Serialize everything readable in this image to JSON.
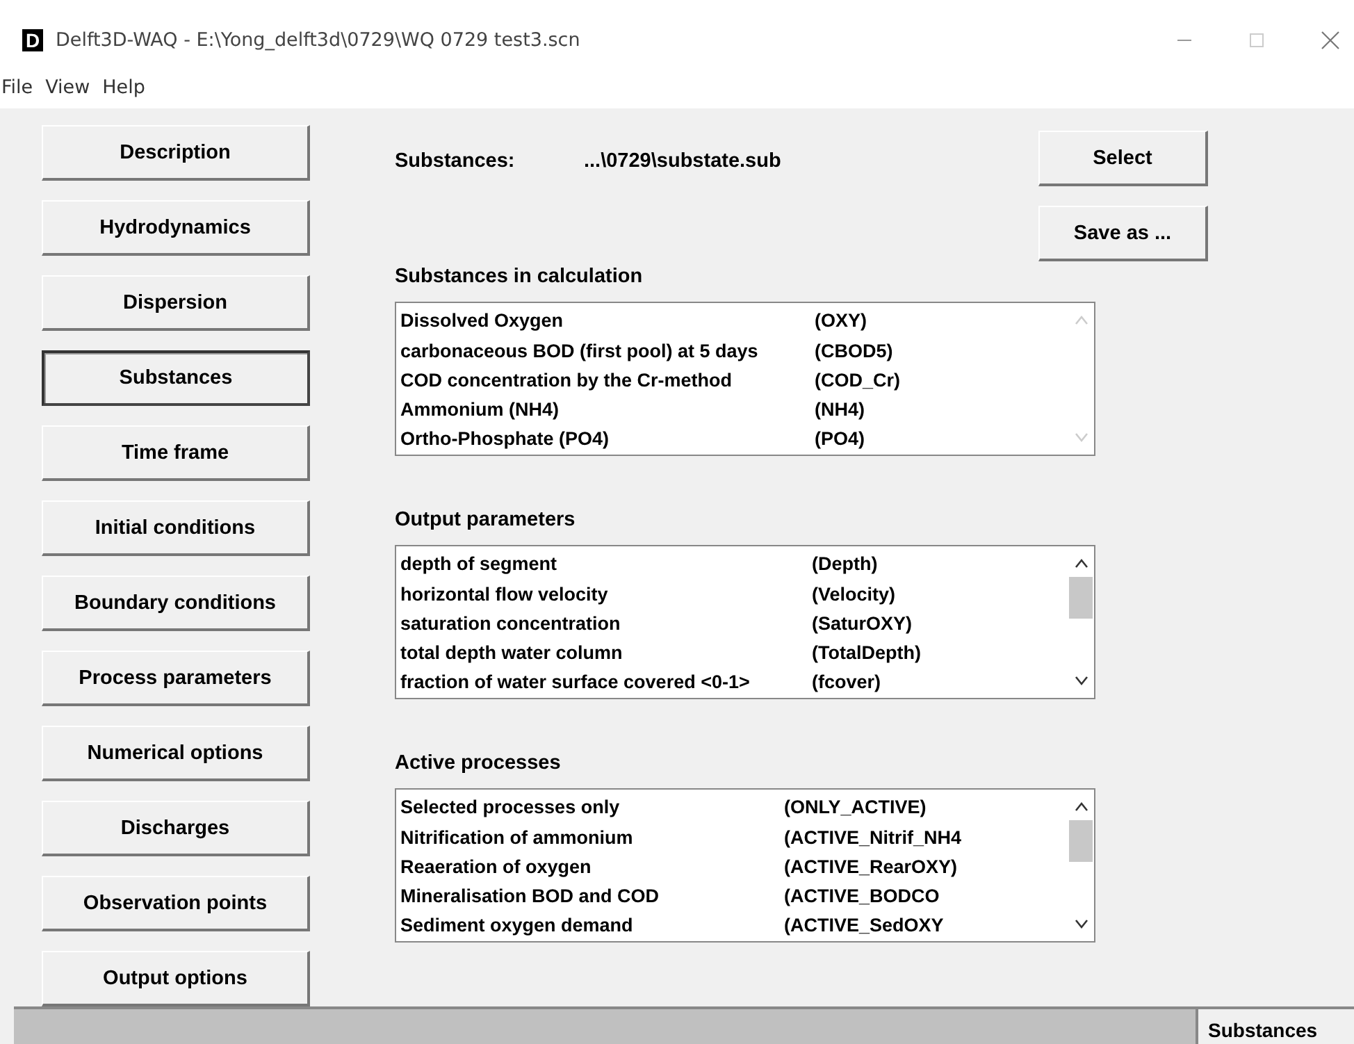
{
  "window": {
    "title": "Delft3D-WAQ - E:\\Yong_delft3d\\0729\\WQ 0729 test3.scn",
    "app_letter": "D"
  },
  "menu": [
    "File",
    "View",
    "Help"
  ],
  "sidebar": {
    "items": [
      {
        "label": "Description",
        "selected": false
      },
      {
        "label": "Hydrodynamics",
        "selected": false
      },
      {
        "label": "Dispersion",
        "selected": false
      },
      {
        "label": "Substances",
        "selected": true
      },
      {
        "label": "Time frame",
        "selected": false
      },
      {
        "label": "Initial conditions",
        "selected": false
      },
      {
        "label": "Boundary conditions",
        "selected": false
      },
      {
        "label": "Process parameters",
        "selected": false
      },
      {
        "label": "Numerical options",
        "selected": false
      },
      {
        "label": "Discharges",
        "selected": false
      },
      {
        "label": "Observation points",
        "selected": false
      },
      {
        "label": "Output options",
        "selected": false
      }
    ]
  },
  "file": {
    "label": "Substances:",
    "value": "...\\0729\\substate.sub"
  },
  "buttons": [
    "Select",
    "Save as ..."
  ],
  "lists": [
    {
      "title": "Substances in calculation",
      "scrollable": false,
      "rows": [
        {
          "name": "Dissolved Oxygen",
          "code": "(OXY)"
        },
        {
          "name": "carbonaceous BOD (first pool) at 5 days",
          "code": "(CBOD5)"
        },
        {
          "name": "COD concentration by the Cr-method",
          "code": "(COD_Cr)"
        },
        {
          "name": "Ammonium (NH4)",
          "code": "(NH4)"
        },
        {
          "name": "Ortho-Phosphate (PO4)",
          "code": "(PO4)"
        }
      ]
    },
    {
      "title": "Output parameters",
      "scrollable": true,
      "rows": [
        {
          "name": "depth of segment",
          "code": "(Depth)"
        },
        {
          "name": "horizontal flow velocity",
          "code": "(Velocity)"
        },
        {
          "name": "saturation concentration",
          "code": "(SaturOXY)"
        },
        {
          "name": "total depth water column",
          "code": "(TotalDepth)"
        },
        {
          "name": "fraction of water surface covered <0-1>",
          "code": "(fcover)"
        }
      ]
    },
    {
      "title": "Active processes",
      "scrollable": true,
      "rows": [
        {
          "name": "Selected processes only",
          "code": "(ONLY_ACTIVE)"
        },
        {
          "name": "Nitrification of ammonium",
          "code": "(ACTIVE_Nitrif_NH4"
        },
        {
          "name": "Reaeration of oxygen",
          "code": "(ACTIVE_RearOXY)"
        },
        {
          "name": "Mineralisation BOD and COD",
          "code": "(ACTIVE_BODCO"
        },
        {
          "name": "Sediment oxygen demand",
          "code": "(ACTIVE_SedOXY"
        }
      ]
    }
  ],
  "status_bar": {
    "panel": "Substances"
  }
}
